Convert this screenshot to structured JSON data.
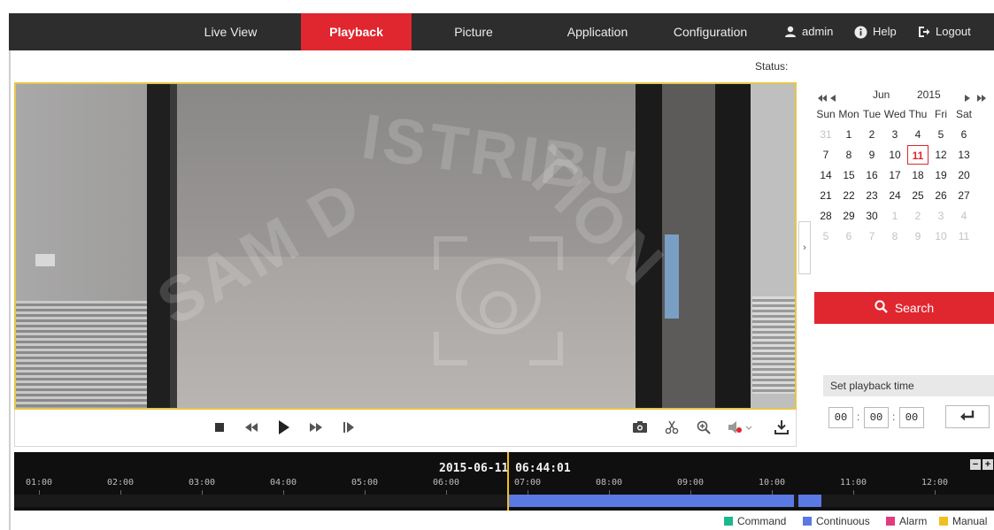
{
  "nav": {
    "tabs": [
      {
        "label": "Live View"
      },
      {
        "label": "Playback"
      },
      {
        "label": "Picture"
      },
      {
        "label": "Application"
      },
      {
        "label": "Configuration"
      }
    ],
    "active_tab": "Playback",
    "user": "admin",
    "help": "Help",
    "logout": "Logout"
  },
  "status": {
    "label": "Status:"
  },
  "video": {
    "watermark_text": "SAM DISTRIBUTION",
    "watermark_color": "#ffffff"
  },
  "controls": {
    "playback": [
      "stop-icon",
      "slow-forward-icon",
      "play-icon",
      "fast-forward-icon",
      "single-frame-icon"
    ],
    "tools": [
      "capture-icon",
      "clip-icon",
      "digital-zoom-icon",
      "volume-off-icon",
      "download-icon"
    ]
  },
  "calendar": {
    "month": "Jun",
    "year": "2015",
    "weekdays": [
      "Sun",
      "Mon",
      "Tue",
      "Wed",
      "Thu",
      "Fri",
      "Sat"
    ],
    "weeks": [
      [
        "31",
        "1",
        "2",
        "3",
        "4",
        "5",
        "6"
      ],
      [
        "7",
        "8",
        "9",
        "10",
        "11",
        "12",
        "13"
      ],
      [
        "14",
        "15",
        "16",
        "17",
        "18",
        "19",
        "20"
      ],
      [
        "21",
        "22",
        "23",
        "24",
        "25",
        "26",
        "27"
      ],
      [
        "28",
        "29",
        "30",
        "1",
        "2",
        "3",
        "4"
      ],
      [
        "5",
        "6",
        "7",
        "8",
        "9",
        "10",
        "11"
      ]
    ],
    "selected_day": "11"
  },
  "search": {
    "label": "Search"
  },
  "playback_time": {
    "title": "Set playback time",
    "hour": "00",
    "minute": "00",
    "second": "00"
  },
  "timeline": {
    "current": "2015-06-11 06:44:01",
    "hours": [
      "01:00",
      "02:00",
      "03:00",
      "04:00",
      "05:00",
      "06:00",
      "07:00",
      "08:00",
      "09:00",
      "10:00",
      "11:00",
      "12:00"
    ],
    "recording_color": "#5b79e4",
    "cursor_color": "#f0c020"
  },
  "legend": [
    {
      "label": "Command",
      "color": "#1bb88c"
    },
    {
      "label": "Continuous",
      "color": "#5b79e4"
    },
    {
      "label": "Alarm",
      "color": "#e23b7d"
    },
    {
      "label": "Manual",
      "color": "#f0c020"
    }
  ],
  "colors": {
    "accent": "#e0262e",
    "nav_bg": "#2d2d2d",
    "video_border": "#e7c64a"
  }
}
